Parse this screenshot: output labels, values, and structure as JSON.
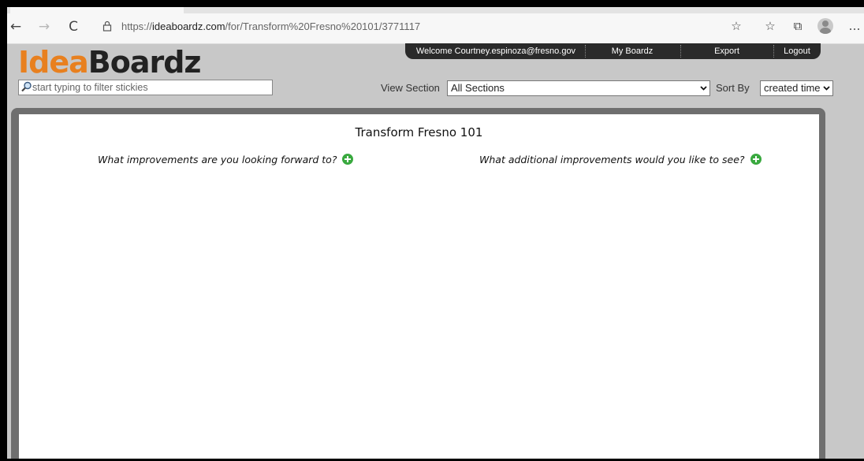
{
  "browser": {
    "back_icon": "←",
    "forward_icon": "→",
    "refresh_icon": "C",
    "url_prefix": "https://",
    "url_host": "ideaboardz.com",
    "url_path": "/for/Transform%20Fresno%20101/3771117",
    "tool_icons": [
      "☆",
      "☆",
      "⧉",
      "…"
    ]
  },
  "header": {
    "logo_part1": "Idea",
    "logo_part2": "Boardz",
    "welcome": "Welcome Courtney.espinoza@fresno.gov",
    "my_boardz": "My Boardz",
    "export": "Export",
    "logout": "Logout"
  },
  "filter": {
    "placeholder": "start typing to filter stickies"
  },
  "controls": {
    "view_section_label": "View Section",
    "view_section_value": "All Sections",
    "sort_by_label": "Sort By",
    "sort_by_value": "created time"
  },
  "board": {
    "title": "Transform Fresno 101",
    "sections": [
      {
        "title": "What improvements are you looking forward to?"
      },
      {
        "title": "What additional improvements would you like to see?"
      }
    ]
  },
  "colors": {
    "logo_accent": "#e8801f",
    "add_button": "#39a93f",
    "board_border": "#6f6f6f"
  }
}
